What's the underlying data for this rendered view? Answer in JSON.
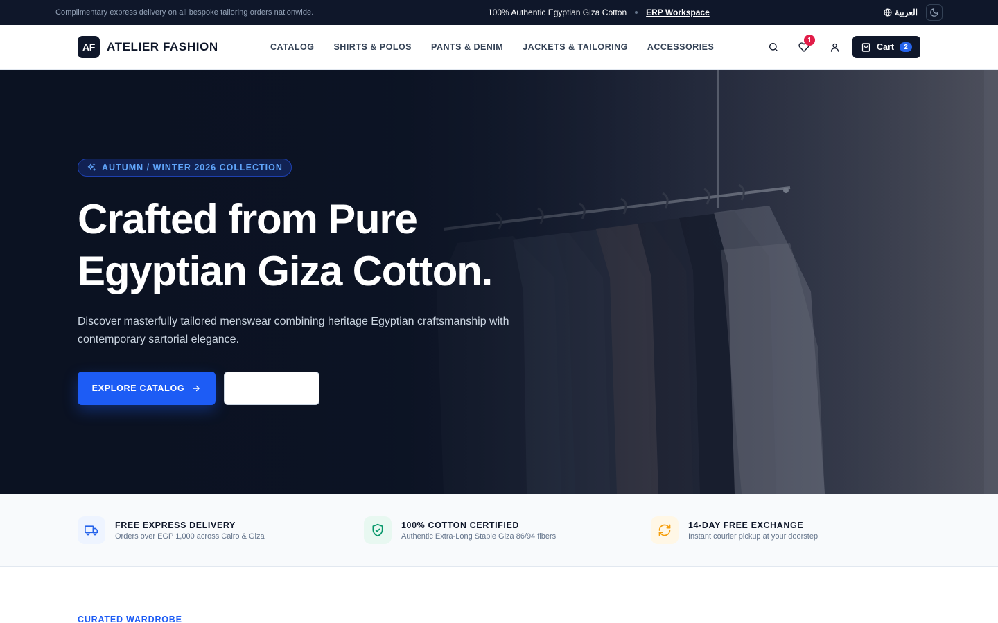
{
  "announcement": {
    "promo": "Complimentary express delivery on all bespoke tailoring orders nationwide.",
    "authentic": "100% Authentic Egyptian Giza Cotton",
    "erp_link": "ERP Workspace",
    "language": "العربية"
  },
  "header": {
    "logo_mark": "AF",
    "brand": "ATELIER FASHION",
    "nav": [
      {
        "label": "CATALOG"
      },
      {
        "label": "SHIRTS & POLOS"
      },
      {
        "label": "PANTS & DENIM"
      },
      {
        "label": "JACKETS & TAILORING"
      },
      {
        "label": "ACCESSORIES"
      }
    ],
    "wishlist_count": "1",
    "cart_label": "Cart",
    "cart_count": "2"
  },
  "hero": {
    "eyebrow": "AUTUMN / WINTER 2026 COLLECTION",
    "headline_line1": "Crafted from Pure",
    "headline_line2": "Egyptian Giza Cotton.",
    "subcopy": "Discover masterfully tailored menswear combining heritage Egyptian craftsmanship with contemporary sartorial elegance.",
    "primary_cta": "EXPLORE CATALOG",
    "secondary_cta": ""
  },
  "features": [
    {
      "title": "FREE EXPRESS DELIVERY",
      "desc": "Orders over EGP 1,000 across Cairo & Giza",
      "icon": "truck-icon",
      "color": "#2563eb",
      "bg": "#eef4ff"
    },
    {
      "title": "100% COTTON CERTIFIED",
      "desc": "Authentic Extra-Long Staple Giza 86/94 fibers",
      "icon": "shield-check-icon",
      "color": "#059669",
      "bg": "#e8f8f1"
    },
    {
      "title": "14-DAY FREE EXCHANGE",
      "desc": "Instant courier pickup at your doorstep",
      "icon": "refresh-icon",
      "color": "#f59e0b",
      "bg": "#fff7e6"
    }
  ],
  "section": {
    "eyebrow": "CURATED WARDROBE"
  },
  "colors": {
    "navy": "#0f172a",
    "accent": "#1d5cf5",
    "badge": "#e11d48"
  }
}
